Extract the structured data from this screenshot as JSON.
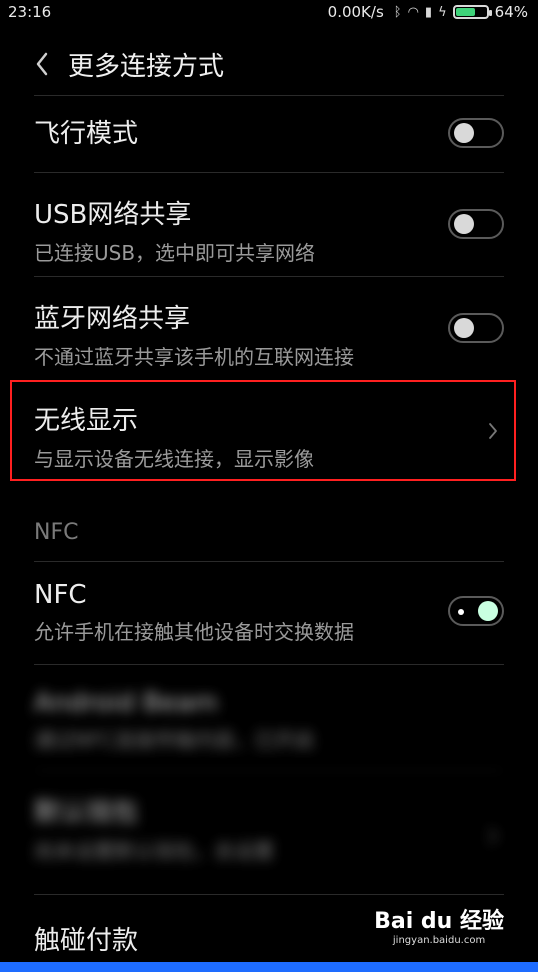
{
  "status": {
    "time": "23:16",
    "speed": "0.00K/s",
    "battery": "64%",
    "battery_level": 0.64,
    "icons": [
      "bluetooth-icon",
      "wifi-icon",
      "signal-icon",
      "charging-icon",
      "battery-icon"
    ]
  },
  "header": {
    "title": "更多连接方式"
  },
  "rows": [
    {
      "title": "飞行模式",
      "subtitle": ""
    },
    {
      "title": "USB网络共享",
      "subtitle": "已连接USB，选中即可共享网络"
    },
    {
      "title": "蓝牙网络共享",
      "subtitle": "不通过蓝牙共享该手机的互联网连接"
    },
    {
      "title": "无线显示",
      "subtitle": "与显示设备无线连接，显示影像"
    },
    {
      "title": "NFC",
      "subtitle": "允许手机在接触其他设备时交换数据"
    },
    {
      "title": "Android Beam",
      "subtitle": "通过NFC连接传输内容，已开启"
    },
    {
      "title": "默认钱包",
      "subtitle": "尚未设置默认钱包，去设置"
    },
    {
      "title": "触碰付款",
      "subtitle": ""
    }
  ],
  "section": {
    "nfc_label": "NFC"
  },
  "watermark": {
    "brand": "Bai du 经验",
    "url": "jingyan.baidu.com"
  },
  "colors": {
    "highlight": "#ff2020",
    "toggle_on": "#c9ffe1",
    "battery": "#3fd37a"
  }
}
